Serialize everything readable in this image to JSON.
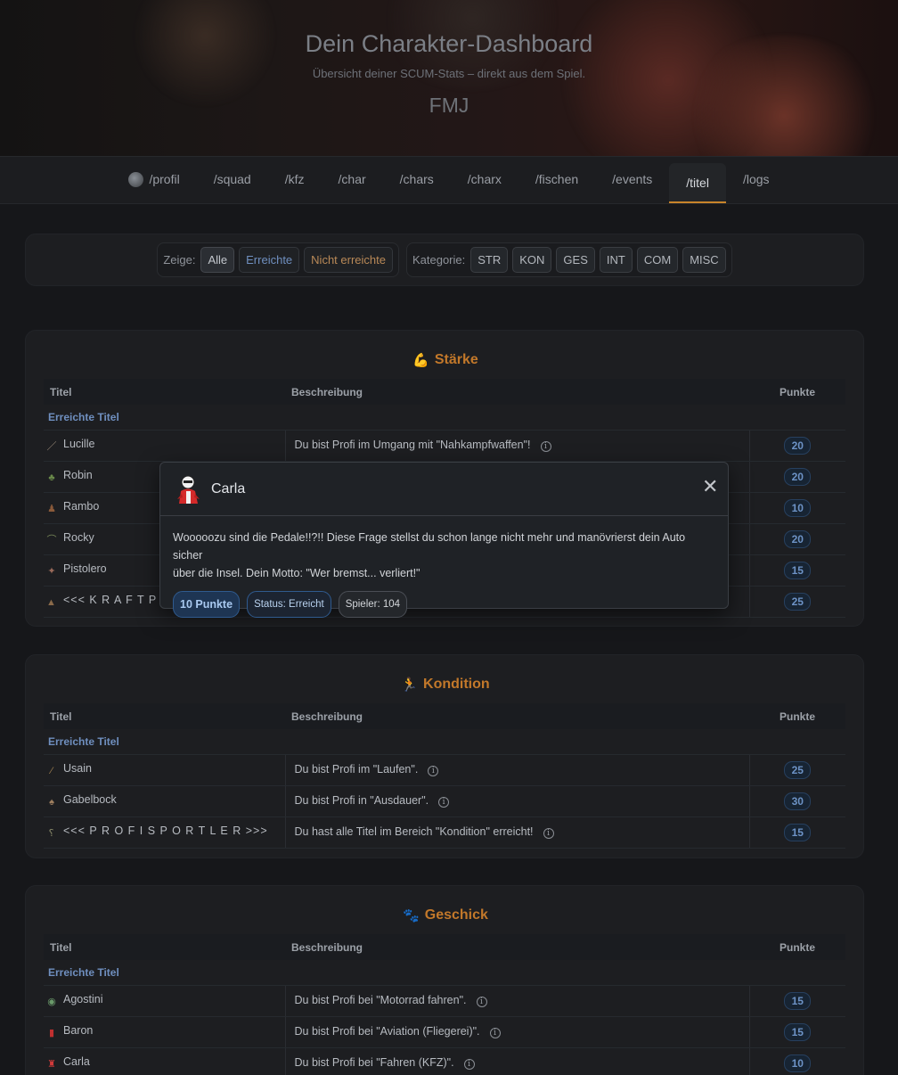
{
  "header": {
    "title": "Dein Charakter-Dashboard",
    "subtitle": "Übersicht deiner SCUM-Stats – direkt aus dem Spiel.",
    "player": "FMJ"
  },
  "nav": {
    "items": [
      {
        "label": "/profil"
      },
      {
        "label": "/squad"
      },
      {
        "label": "/kfz"
      },
      {
        "label": "/char"
      },
      {
        "label": "/chars"
      },
      {
        "label": "/charx"
      },
      {
        "label": "/fischen"
      },
      {
        "label": "/events"
      },
      {
        "label": "/titel"
      },
      {
        "label": "/logs"
      }
    ],
    "active": "/titel"
  },
  "filters": {
    "show_label": "Zeige:",
    "show": [
      "Alle",
      "Erreichte",
      "Nicht erreichte"
    ],
    "category_label": "Kategorie:",
    "categories": [
      "STR",
      "KON",
      "GES",
      "INT",
      "COM",
      "MISC"
    ]
  },
  "table_headers": {
    "title": "Titel",
    "description": "Beschreibung",
    "points": "Punkte"
  },
  "group_label": "Erreichte Titel",
  "sections": [
    {
      "name": "Stärke",
      "icon": "flexed-biceps-icon",
      "rows": [
        {
          "title": "Lucille",
          "desc": "Du bist Profi im Umgang mit \"Nahkampfwaffen\"!",
          "points": "20"
        },
        {
          "title": "Robin",
          "desc": "",
          "points": "20"
        },
        {
          "title": "Rambo",
          "desc": "",
          "points": "10"
        },
        {
          "title": "Rocky",
          "desc": "",
          "points": "20"
        },
        {
          "title": "Pistolero",
          "desc": "",
          "points": "15"
        },
        {
          "title": "<<< K R A F T P R O",
          "desc": "",
          "points": "25"
        }
      ]
    },
    {
      "name": "Kondition",
      "icon": "runner-icon",
      "rows": [
        {
          "title": "Usain",
          "desc": "Du bist Profi im \"Laufen\".",
          "points": "25"
        },
        {
          "title": "Gabelbock",
          "desc": "Du bist Profi in \"Ausdauer\".",
          "points": "30"
        },
        {
          "title": "<<< P R O F I S P O R T L E R >>>",
          "desc": "Du hast alle Titel im Bereich \"Kondition\" erreicht!",
          "points": "15"
        }
      ]
    },
    {
      "name": "Geschick",
      "icon": "paw-skill-icon",
      "rows": [
        {
          "title": "Agostini",
          "desc": "Du bist Profi bei \"Motorrad fahren\".",
          "points": "15"
        },
        {
          "title": "Baron",
          "desc": "Du bist Profi bei \"Aviation (Fliegerei)\".",
          "points": "15"
        },
        {
          "title": "Carla",
          "desc": "Du bist Profi bei \"Fahren (KFZ)\".",
          "points": "10"
        }
      ]
    }
  ],
  "modal": {
    "name": "Carla",
    "text_line1": "Wooooozu sind die Pedale!!?!! Diese Frage stellst du schon lange nicht mehr und manövrierst dein Auto sicher",
    "text_line2": "über die Insel. Dein Motto: \"Wer bremst... verliert!\"",
    "points": "10 Punkte",
    "status": "Status: Erreicht",
    "players": "Spieler: 104",
    "close": "✕"
  },
  "colors": {
    "accent": "#c2782a",
    "link": "#6f8fbf",
    "badge": "#6d93c6"
  }
}
